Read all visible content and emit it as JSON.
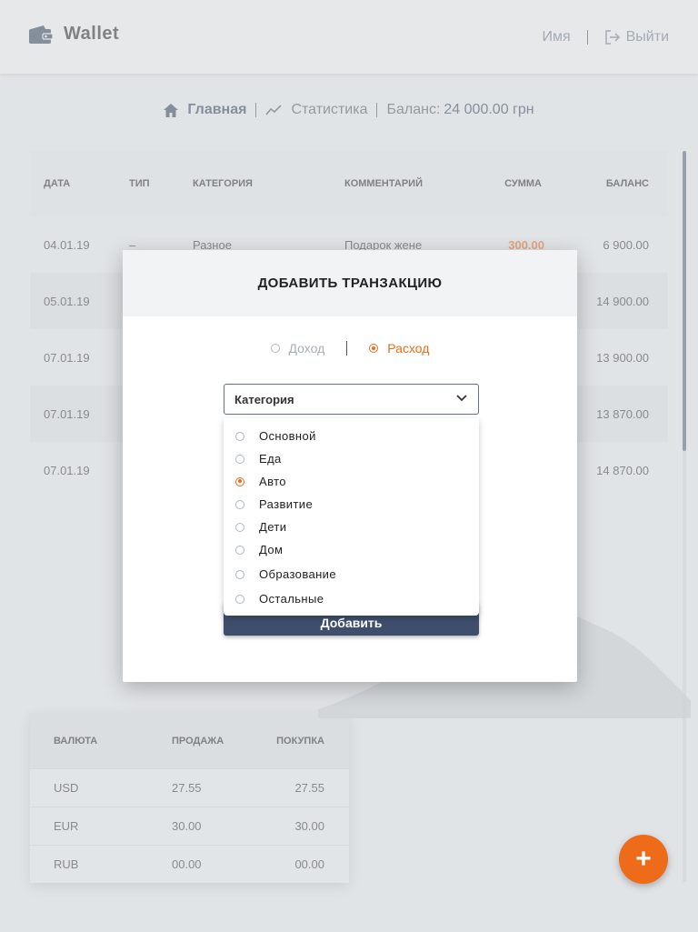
{
  "app": {
    "title": "Wallet"
  },
  "header": {
    "user_name": "Имя",
    "logout_label": "Выйти"
  },
  "nav": {
    "home_label": "Главная",
    "stats_label": "Статистика",
    "balance_label": "Баланс:",
    "balance_value": "24 000.00 грн"
  },
  "transactions": {
    "columns": [
      "ДАТА",
      "ТИП",
      "КАТЕГОРИЯ",
      "КОММЕНТАРИЙ",
      "СУММА",
      "БАЛАНС"
    ],
    "rows": [
      {
        "date": "04.01.19",
        "type": "–",
        "category": "Разное",
        "comment": "Подарок жене",
        "sum": "300.00",
        "balance": "6 900.00"
      },
      {
        "date": "05.01.19",
        "type": "",
        "category": "",
        "comment": "",
        "sum": "",
        "balance": "14 900.00"
      },
      {
        "date": "07.01.19",
        "type": "",
        "category": "",
        "comment": "",
        "sum": "",
        "balance": "13 900.00"
      },
      {
        "date": "07.01.19",
        "type": "",
        "category": "",
        "comment": "",
        "sum": "",
        "balance": "13 870.00"
      },
      {
        "date": "07.01.19",
        "type": "",
        "category": "",
        "comment": "",
        "sum": "",
        "balance": "14 870.00"
      }
    ]
  },
  "currency": {
    "columns": [
      "ВАЛЮТА",
      "ПРОДАЖА",
      "ПОКУПКА"
    ],
    "rows": [
      {
        "code": "USD",
        "sell": "27.55",
        "buy": "27.55"
      },
      {
        "code": "EUR",
        "sell": "30.00",
        "buy": "30.00"
      },
      {
        "code": "RUB",
        "sell": "00.00",
        "buy": "00.00"
      }
    ]
  },
  "modal": {
    "title": "ДОБАВИТЬ ТРАНЗАКЦИЮ",
    "income_label": "Доход",
    "expense_label": "Расход",
    "selected_type": "expense",
    "category_placeholder": "Категория",
    "categories": [
      "Основной",
      "Еда",
      "Авто",
      "Развитие",
      "Дети",
      "Дом",
      "Образование",
      "Остальные"
    ],
    "selected_category": "Авто",
    "submit_label": "Добавить"
  },
  "fab": {
    "label": "+"
  },
  "colors": {
    "accent": "#ee6b1a",
    "primary": "#3d4f6c",
    "background": "#e7e9ea"
  }
}
